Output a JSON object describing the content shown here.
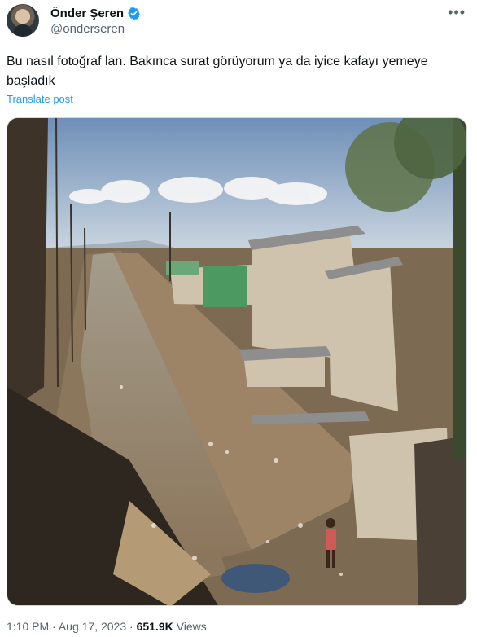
{
  "author": {
    "display_name": "Önder Şeren",
    "handle": "@onderseren",
    "verified": true
  },
  "post": {
    "text": "Bu nasıl fotoğraf lan. Bakınca surat görüyorum ya da iyice kafayı yemeye başladık",
    "translate_label": "Translate post",
    "time": "1:10 PM",
    "separator": "·",
    "date": "Aug 17, 2023",
    "views_count": "651.9K",
    "views_label": "Views"
  },
  "icons": {
    "verified": "verified-badge-icon",
    "more": "more-options-icon"
  },
  "colors": {
    "accent": "#1d9bf0",
    "secondary_text": "#536471",
    "primary_text": "#0f1419"
  }
}
